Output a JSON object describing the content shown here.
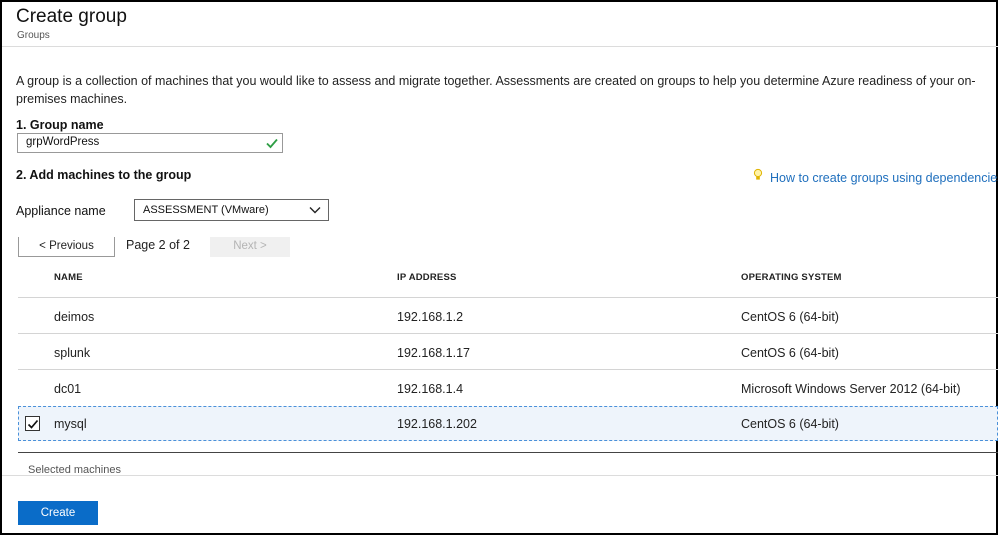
{
  "header": {
    "title": "Create group",
    "breadcrumb": "Groups"
  },
  "description": {
    "line1": "A group is a collection of machines that you would like to assess and migrate together. Assessments are created on groups to help you determine Azure readiness of your on-",
    "line2": "premises machines."
  },
  "group_name": {
    "label": "1. Group name",
    "value": "grpWordPress",
    "icon": "check-icon"
  },
  "add_machines": {
    "label": "2. Add machines to the group",
    "help_link": "How to create groups using dependencies",
    "help_icon": "lightbulb-icon"
  },
  "appliance": {
    "label": "Appliance name",
    "selected": "ASSESSMENT (VMware)"
  },
  "pager": {
    "previous": "< Previous",
    "indicator": "Page 2 of 2",
    "next": "Next >"
  },
  "table": {
    "columns": [
      "NAME",
      "IP ADDRESS",
      "OPERATING SYSTEM"
    ],
    "rows": [
      {
        "name": "deimos",
        "ip": "192.168.1.2",
        "os": "CentOS 6 (64-bit)",
        "checked": false
      },
      {
        "name": "splunk",
        "ip": "192.168.1.17",
        "os": "CentOS 6 (64-bit)",
        "checked": false
      },
      {
        "name": "dc01",
        "ip": "192.168.1.4",
        "os": "Microsoft Windows Server 2012 (64-bit)",
        "checked": false
      },
      {
        "name": "mysql",
        "ip": "192.168.1.202",
        "os": "CentOS 6 (64-bit)",
        "checked": true
      }
    ]
  },
  "selected_machines_label": "Selected machines",
  "create_button": "Create",
  "colors": {
    "accent": "#0a6cc8",
    "link": "#1f6fbd",
    "success": "#2e9e44",
    "selected_row": "#eef4fb"
  }
}
